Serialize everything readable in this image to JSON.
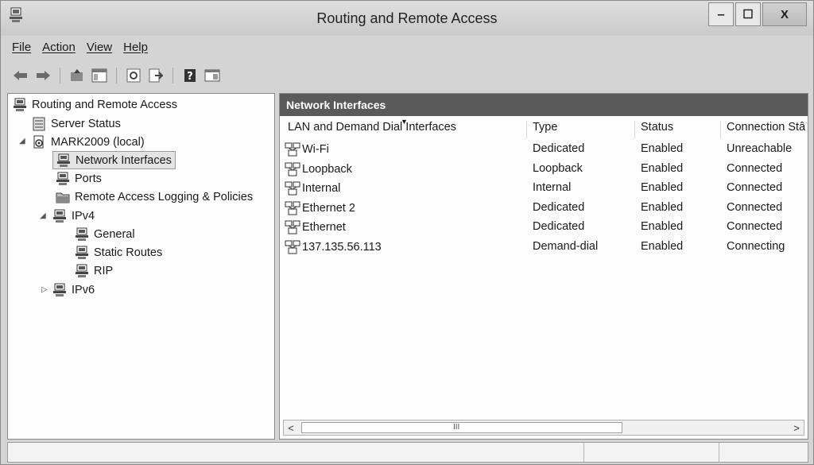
{
  "window": {
    "title": "Routing and Remote Access",
    "controls": [
      "‒",
      "☐",
      "X"
    ]
  },
  "menubar": [
    "File",
    "Action",
    "View",
    "Help"
  ],
  "toolbar_icons": [
    "back-arrow-icon",
    "forward-arrow-icon",
    "up-folder-icon",
    "show-hide-tree-icon",
    "refresh-icon",
    "export-icon",
    "help-icon",
    "properties-icon"
  ],
  "tree": {
    "root": "Routing and Remote Access",
    "server_status": "Server Status",
    "server": "MARK2009 (local)",
    "network_interfaces": "Network Interfaces",
    "ports": "Ports",
    "logging": "Remote Access Logging & Policies",
    "ipv4": "IPv4",
    "general": "General",
    "static_routes": "Static Routes",
    "rip": "RIP",
    "ipv6": "IPv6"
  },
  "details": {
    "header": "Network Interfaces",
    "columns": [
      "LAN and Demand Dial Interfaces",
      "Type",
      "Status",
      "Connection Stâ"
    ],
    "rows": [
      {
        "name": "Wi-Fi",
        "type": "Dedicated",
        "status": "Enabled",
        "connection": "Unreachable"
      },
      {
        "name": "Loopback",
        "type": "Loopback",
        "status": "Enabled",
        "connection": "Connected"
      },
      {
        "name": "Internal",
        "type": "Internal",
        "status": "Enabled",
        "connection": "Connected"
      },
      {
        "name": "Ethernet 2",
        "type": "Dedicated",
        "status": "Enabled",
        "connection": "Connected"
      },
      {
        "name": "Ethernet",
        "type": "Dedicated",
        "status": "Enabled",
        "connection": "Connected"
      },
      {
        "name": "137.135.56.113",
        "type": "Demand-dial",
        "status": "Enabled",
        "connection": "Connecting"
      }
    ]
  },
  "scrollbar": {
    "left": "<",
    "right": ">",
    "grip": "III"
  },
  "colors": {
    "header_bg": "#5a5a5a",
    "window_bg": "#d4d4d4",
    "pane_bg": "#fdfdfd"
  }
}
